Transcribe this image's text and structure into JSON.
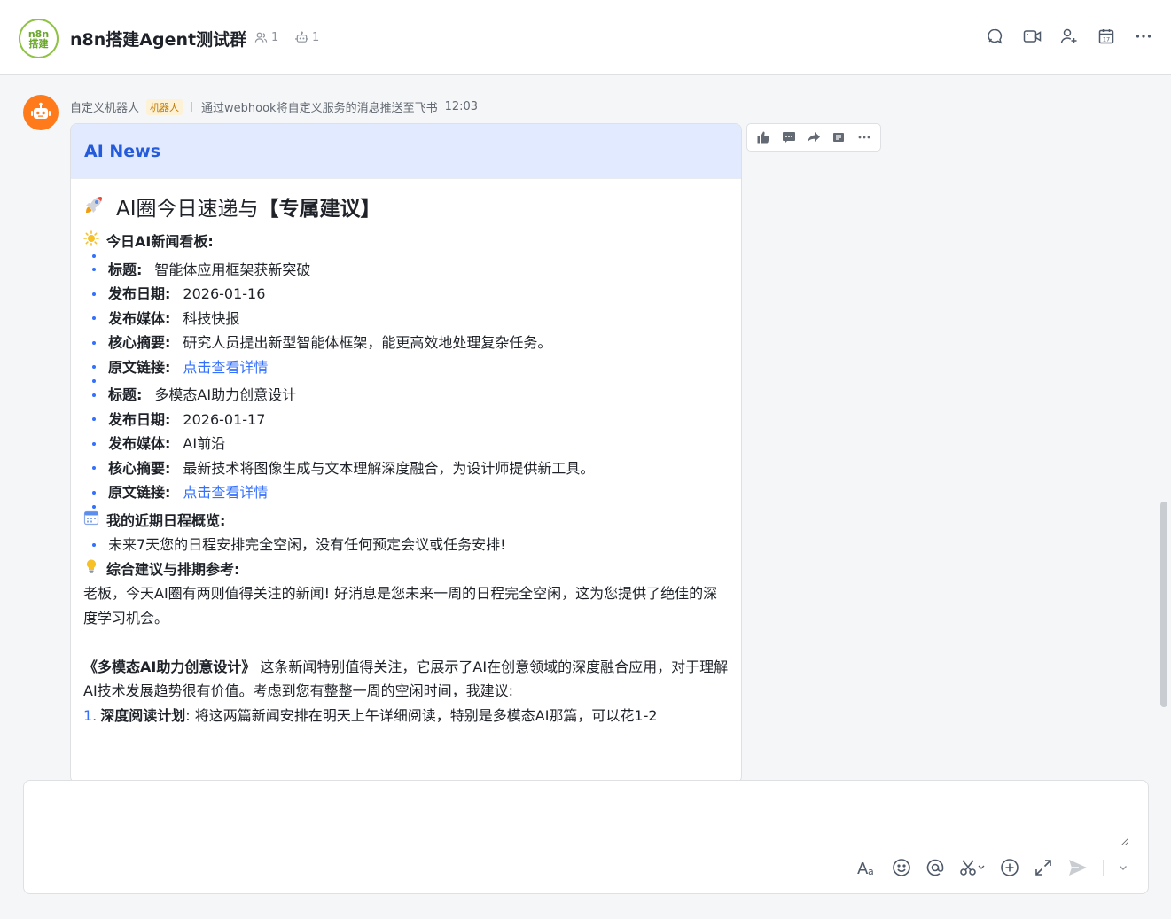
{
  "header": {
    "avatar_line1": "n8n",
    "avatar_line2": "搭建",
    "title": "n8n搭建Agent测试群",
    "member_count": "1",
    "bot_count": "1"
  },
  "message": {
    "sender": "自定义机器人",
    "badge": "机器人",
    "description": "通过webhook将自定义服务的消息推送至飞书",
    "time": "12:03"
  },
  "card": {
    "header_title": "AI News",
    "title_normal": "AI圈今日速递与",
    "title_bold": "【专属建议】",
    "news_section": "今日AI新闻看板:",
    "news": [
      {
        "title_label": "标题:",
        "title": "智能体应用框架获新突破",
        "date_label": "发布日期:",
        "date": "2026-01-16",
        "media_label": "发布媒体:",
        "media": "科技快报",
        "summary_label": "核心摘要:",
        "summary": "研究人员提出新型智能体框架，能更高效地处理复杂任务。",
        "link_label": "原文链接:",
        "link_text": "点击查看详情"
      },
      {
        "title_label": "标题:",
        "title": "多模态AI助力创意设计",
        "date_label": "发布日期:",
        "date": "2026-01-17",
        "media_label": "发布媒体:",
        "media": "AI前沿",
        "summary_label": "核心摘要:",
        "summary": "最新技术将图像生成与文本理解深度融合，为设计师提供新工具。",
        "link_label": "原文链接:",
        "link_text": "点击查看详情"
      }
    ],
    "schedule_section": "我的近期日程概览:",
    "schedule_item": "未来7天您的日程安排完全空闲，没有任何预定会议或任务安排!",
    "advice_section": "综合建议与排期参考:",
    "advice_para1": "老板，今天AI圈有两则值得关注的新闻! 好消息是您未来一周的日程完全空闲，这为您提供了绝佳的深度学习机会。",
    "advice_para2_bold": "《多模态AI助力创意设计》",
    "advice_para2": " 这条新闻特别值得关注，它展示了AI在创意领域的深度融合应用，对于理解AI技术发展趋势很有价值。考虑到您有整整一周的空闲时间，我建议:",
    "step1_num": "1.",
    "step1_bold": "深度阅读计划",
    "step1_text": ": 将这两篇新闻安排在明天上午详细阅读，特别是多模态AI那篇，可以花1-2"
  },
  "reaction_bar": [
    "thumbs-up",
    "comment",
    "forward",
    "pin",
    "more"
  ],
  "composer": {
    "placeholder": "",
    "tools": [
      "font-style",
      "emoji",
      "mention",
      "screenshot",
      "add",
      "expand",
      "send"
    ]
  },
  "colors": {
    "accent": "#3370ff",
    "card_header_bg": "#e1eaff",
    "bot_avatar": "#ff7a1a",
    "badge_bg": "#fdf1d6"
  }
}
